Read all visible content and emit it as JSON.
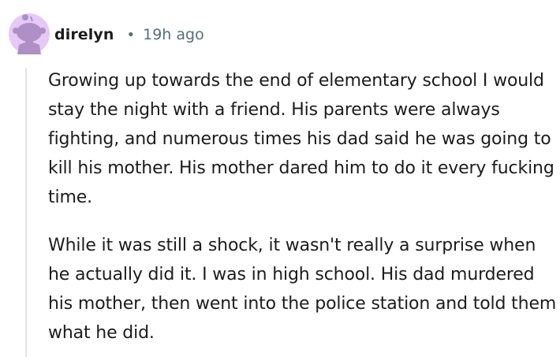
{
  "comment": {
    "author": "direlyn",
    "separator": "•",
    "timestamp": "19h ago",
    "avatar_icon": "reddit-snoo-avatar-icon",
    "paragraphs": [
      "Growing up towards the end of elementary school I would stay the night with a friend. His parents were always fighting, and numerous times his dad said he was going to kill his mother. His mother dared him to do it every fucking time.",
      "While it was still a shock, it wasn't really a surprise when he actually did it. I was in high school. His dad murdered his mother, then went into the police station and told them what he did."
    ]
  },
  "colors": {
    "avatar_bg": "#e6c9f7",
    "avatar_figure": "#b08fc7",
    "meta_text": "#576f76",
    "body_text": "#1c1c1c",
    "thread_line": "#e2e6e8"
  }
}
